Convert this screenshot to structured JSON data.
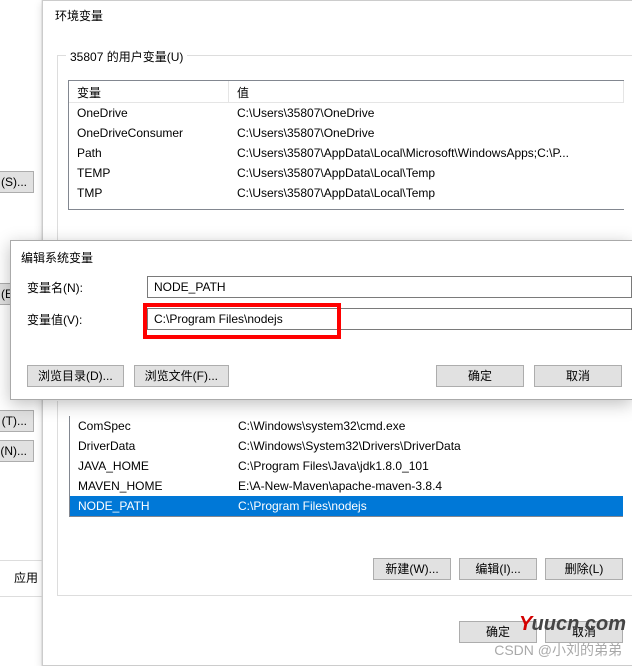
{
  "left_strip": {
    "btn_s": "(S)...",
    "btn_e": "(E)...",
    "btn_t": "(T)...",
    "btn_n": "(N)...",
    "tag": "应用"
  },
  "env_window": {
    "title": "环境变量",
    "user_group_legend": "35807 的用户变量(U)",
    "headers": {
      "var": "变量",
      "val": "值"
    },
    "user_vars": [
      {
        "name": "OneDrive",
        "value": "C:\\Users\\35807\\OneDrive"
      },
      {
        "name": "OneDriveConsumer",
        "value": "C:\\Users\\35807\\OneDrive"
      },
      {
        "name": "Path",
        "value": "C:\\Users\\35807\\AppData\\Local\\Microsoft\\WindowsApps;C:\\P..."
      },
      {
        "name": "TEMP",
        "value": "C:\\Users\\35807\\AppData\\Local\\Temp"
      },
      {
        "name": "TMP",
        "value": "C:\\Users\\35807\\AppData\\Local\\Temp"
      }
    ],
    "sys_vars": [
      {
        "name": "ComSpec",
        "value": "C:\\Windows\\system32\\cmd.exe"
      },
      {
        "name": "DriverData",
        "value": "C:\\Windows\\System32\\Drivers\\DriverData"
      },
      {
        "name": "JAVA_HOME",
        "value": "C:\\Program Files\\Java\\jdk1.8.0_101"
      },
      {
        "name": "MAVEN_HOME",
        "value": "E:\\A-New-Maven\\apache-maven-3.8.4"
      },
      {
        "name": "NODE_PATH",
        "value": "C:\\Program Files\\nodejs",
        "selected": true
      }
    ],
    "buttons": {
      "new": "新建(W)...",
      "edit": "编辑(I)...",
      "delete": "删除(L)",
      "ok": "确定",
      "cancel": "取消"
    }
  },
  "edit_dialog": {
    "title": "编辑系统变量",
    "name_label": "变量名(N):",
    "name_value": "NODE_PATH",
    "value_label": "变量值(V):",
    "value_value": "C:\\Program Files\\nodejs",
    "buttons": {
      "browse_dir": "浏览目录(D)...",
      "browse_file": "浏览文件(F)...",
      "ok": "确定",
      "cancel": "取消"
    }
  },
  "watermarks": {
    "csdn": "CSDN @小刘的弟弟",
    "yuucn_y": "Y",
    "yuucn_rest": "uucn.com"
  }
}
